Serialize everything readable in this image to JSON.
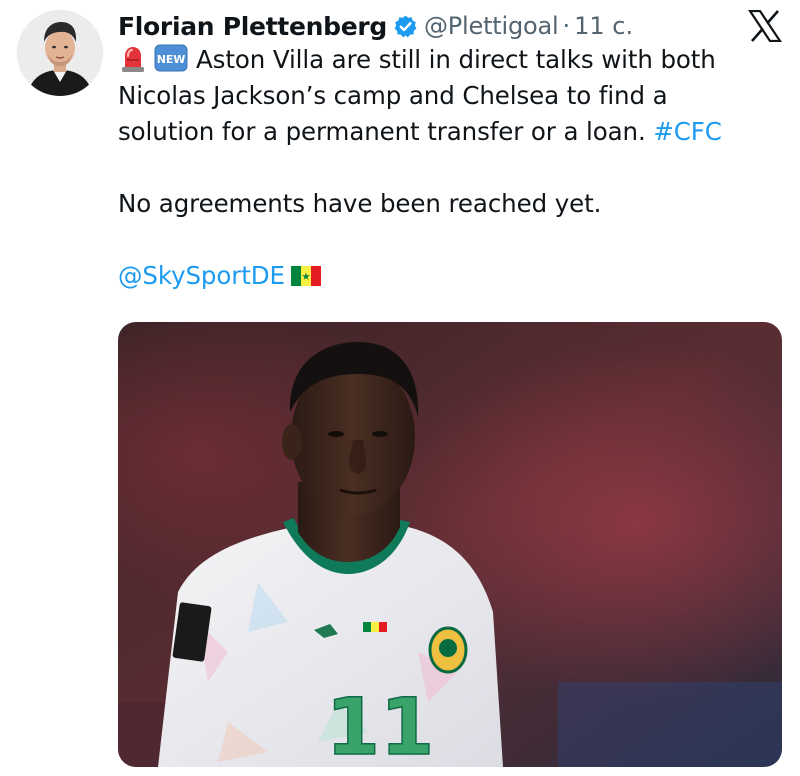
{
  "tweet": {
    "author_name": "Florian Plettenberg",
    "handle": "@Plettigoal",
    "separator": "·",
    "timestamp": "11 c.",
    "badge_new": "NEW",
    "line1": "Aston Villa are still in direct talks with both",
    "line2": "Nicolas Jackson’s camp and Chelsea to find a",
    "line3_text": "solution for a permanent transfer or a loan. ",
    "hashtag": "#CFC",
    "line4": "No agreements have been reached yet.",
    "mention": "@SkySportDE",
    "jersey_number": "11"
  },
  "icons": {
    "avatar": "avatar",
    "verified": "verified-badge-icon",
    "platform": "x-logo-icon",
    "siren": "police-light-emoji",
    "new": "new-button-emoji",
    "flag": "senegal-flag-emoji"
  },
  "colors": {
    "text": "#0f1419",
    "secondary": "#536471",
    "link": "#1d9bf0",
    "verified": "#1d9bf0"
  }
}
